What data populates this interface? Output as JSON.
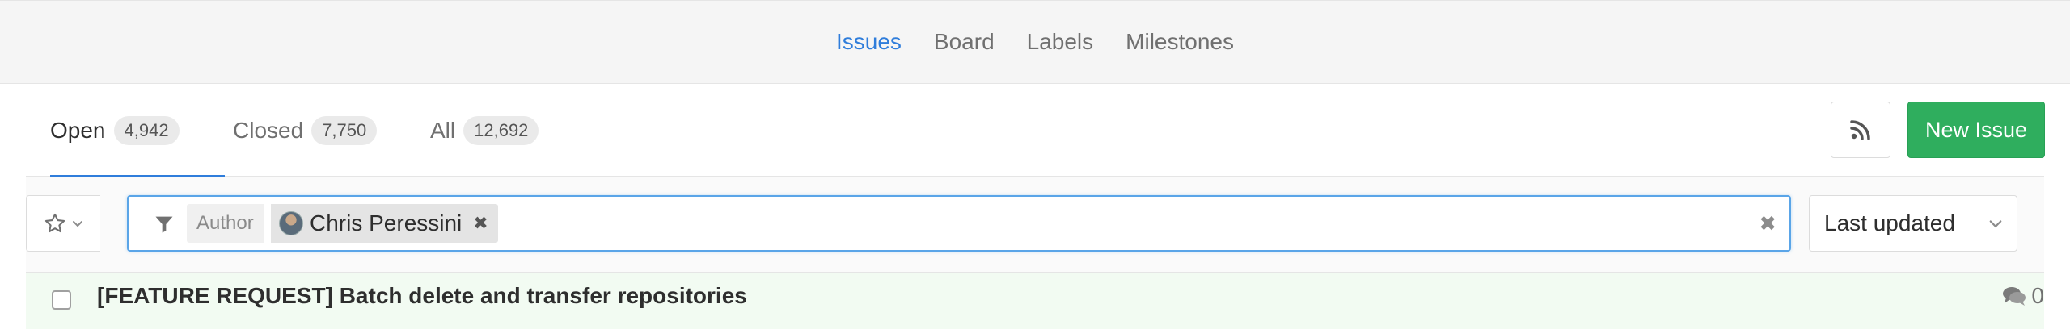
{
  "subnav": {
    "items": [
      {
        "label": "Issues",
        "active": true
      },
      {
        "label": "Board"
      },
      {
        "label": "Labels"
      },
      {
        "label": "Milestones"
      }
    ]
  },
  "tabs": [
    {
      "label": "Open",
      "count": "4,942",
      "active": true
    },
    {
      "label": "Closed",
      "count": "7,750"
    },
    {
      "label": "All",
      "count": "12,692"
    }
  ],
  "actions": {
    "rss_icon": "rss-icon",
    "new_issue_label": "New Issue",
    "new_issue_color": "#2fae5e"
  },
  "filter": {
    "token_name": "Author",
    "token_value": "Chris Peressini",
    "sort_label": "Last updated"
  },
  "issues": [
    {
      "title": "[FEATURE REQUEST] Batch delete and transfer repositories",
      "comments": "0"
    }
  ],
  "colors": {
    "accent": "#2f7ddb",
    "success": "#2fae5e",
    "row_highlight": "#f2fbf2"
  }
}
